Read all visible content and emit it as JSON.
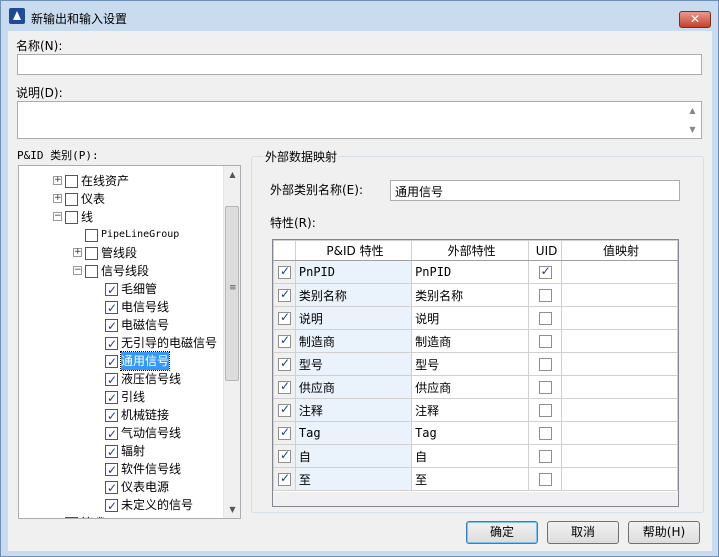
{
  "window": {
    "title": "新输出和输入设置",
    "close_label": "✕"
  },
  "name_label": "名称(N):",
  "name_value": "",
  "desc_label": "说明(D):",
  "desc_value": "",
  "tree": {
    "label": "P&ID 类别(P):",
    "nodes": [
      {
        "text": "在线资产",
        "checked": false,
        "expander": "+",
        "level": 1
      },
      {
        "text": "仪表",
        "checked": false,
        "expander": "+",
        "level": 1
      },
      {
        "text": "线",
        "checked": false,
        "expander": "−",
        "level": 1
      },
      {
        "text": "PipeLineGroup",
        "checked": false,
        "expander": "",
        "level": 2
      },
      {
        "text": "管线段",
        "checked": false,
        "expander": "+",
        "level": 2
      },
      {
        "text": "信号线段",
        "checked": false,
        "expander": "−",
        "level": 2
      },
      {
        "text": "毛细管",
        "checked": true,
        "expander": "",
        "level": 3
      },
      {
        "text": "电信号线",
        "checked": true,
        "expander": "",
        "level": 3
      },
      {
        "text": "电磁信号",
        "checked": true,
        "expander": "",
        "level": 3
      },
      {
        "text": "无引导的电磁信号",
        "checked": true,
        "expander": "",
        "level": 3
      },
      {
        "text": "通用信号",
        "checked": true,
        "expander": "",
        "level": 3,
        "selected": true
      },
      {
        "text": "液压信号线",
        "checked": true,
        "expander": "",
        "level": 3
      },
      {
        "text": "引线",
        "checked": true,
        "expander": "",
        "level": 3
      },
      {
        "text": "机械链接",
        "checked": true,
        "expander": "",
        "level": 3
      },
      {
        "text": "气动信号线",
        "checked": true,
        "expander": "",
        "level": 3
      },
      {
        "text": "辐射",
        "checked": true,
        "expander": "",
        "level": 3
      },
      {
        "text": "软件信号线",
        "checked": true,
        "expander": "",
        "level": 3
      },
      {
        "text": "仪表电源",
        "checked": true,
        "expander": "",
        "level": 3
      },
      {
        "text": "未定义的信号",
        "checked": true,
        "expander": "",
        "level": 3
      },
      {
        "text": "管嘴",
        "checked": false,
        "expander": "+",
        "level": 1
      }
    ]
  },
  "mapping": {
    "group_title": "外部数据映射",
    "ext_class_label": "外部类别名称(E):",
    "ext_class_value": "通用信号",
    "props_label": "特性(R):",
    "columns": [
      "",
      "P&ID 特性",
      "外部特性",
      "UID",
      "值映射"
    ],
    "rows": [
      {
        "checked": true,
        "pid": "PnPID",
        "ext": "PnPID",
        "uid": true,
        "map": ""
      },
      {
        "checked": true,
        "pid": "类别名称",
        "ext": "类别名称",
        "uid": false,
        "map": ""
      },
      {
        "checked": true,
        "pid": "说明",
        "ext": "说明",
        "uid": false,
        "map": ""
      },
      {
        "checked": true,
        "pid": "制造商",
        "ext": "制造商",
        "uid": false,
        "map": ""
      },
      {
        "checked": true,
        "pid": "型号",
        "ext": "型号",
        "uid": false,
        "map": ""
      },
      {
        "checked": true,
        "pid": "供应商",
        "ext": "供应商",
        "uid": false,
        "map": ""
      },
      {
        "checked": true,
        "pid": "注释",
        "ext": "注释",
        "uid": false,
        "map": ""
      },
      {
        "checked": true,
        "pid": "Tag",
        "ext": "Tag",
        "uid": false,
        "map": ""
      },
      {
        "checked": true,
        "pid": "自",
        "ext": "自",
        "uid": false,
        "map": ""
      },
      {
        "checked": true,
        "pid": "至",
        "ext": "至",
        "uid": false,
        "map": ""
      }
    ]
  },
  "buttons": {
    "ok": "确定",
    "cancel": "取消",
    "help": "帮助(H)"
  }
}
